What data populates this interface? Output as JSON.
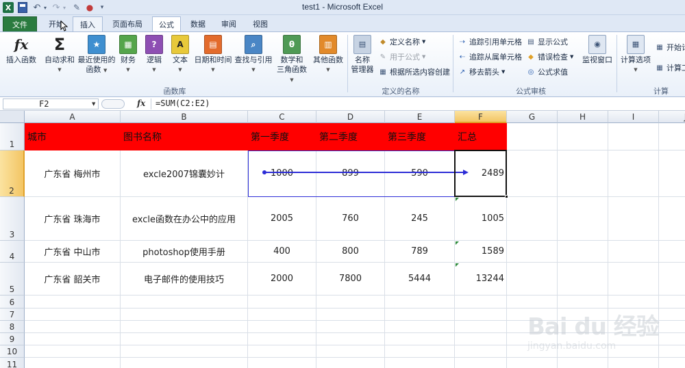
{
  "window": {
    "title": "test1  -  Microsoft Excel"
  },
  "qat": {
    "excel_icon": "X"
  },
  "tabs": {
    "file": "文件",
    "home": "开始",
    "insert": "插入",
    "layout": "页面布局",
    "formulas": "公式",
    "data": "数据",
    "review": "审阅",
    "view": "视图"
  },
  "ribbon": {
    "library": {
      "insert_function": "插入函数",
      "autosum": "自动求和",
      "recent_1": "最近使用的",
      "recent_2": "函数",
      "financial": "财务",
      "logical": "逻辑",
      "text": "文本",
      "datetime": "日期和时间",
      "lookup": "查找与引用",
      "math_1": "数学和",
      "math_2": "三角函数",
      "more": "其他函数",
      "label": "函数库"
    },
    "names": {
      "manager_1": "名称",
      "manager_2": "管理器",
      "define": "定义名称",
      "use": "用于公式",
      "create": "根据所选内容创建",
      "label": "定义的名称"
    },
    "audit": {
      "trace_precedents": "追踪引用单元格",
      "trace_dependents": "追踪从属单元格",
      "remove_arrows": "移去箭头",
      "show_formulas": "显示公式",
      "error_check": "错误检查",
      "evaluate": "公式求值",
      "watch": "监视窗口",
      "label": "公式审核"
    },
    "calc": {
      "options": "计算选项",
      "calc_now": "开始计",
      "calc_sheet": "计算工",
      "label": "计算"
    }
  },
  "formula_bar": {
    "name_box": "F2",
    "fx": "fx",
    "formula": "=SUM(C2:E2)"
  },
  "columns": [
    "A",
    "B",
    "C",
    "D",
    "E",
    "F",
    "G",
    "H",
    "I",
    "J"
  ],
  "rows": [
    "1",
    "2",
    "3",
    "4",
    "5",
    "6",
    "7",
    "8",
    "9",
    "10",
    "11"
  ],
  "sheet": {
    "headers": [
      "城市",
      "图书名称",
      "第一季度",
      "第二季度",
      "第三季度",
      "汇总"
    ],
    "data": [
      [
        "广东省 梅州市",
        "excle2007锦囊妙计",
        "1000",
        "899",
        "590",
        "2489"
      ],
      [
        "广东省 珠海市",
        "excle函数在办公中的应用",
        "2005",
        "760",
        "245",
        "1005"
      ],
      [
        "广东省 中山市",
        "photoshop使用手册",
        "400",
        "800",
        "789",
        "1589"
      ],
      [
        "广东省 韶关市",
        "电子邮件的使用技巧",
        "2000",
        "7800",
        "5444",
        "13244"
      ]
    ]
  },
  "colors": {
    "header_fill": "#ff0000",
    "trace_arrow": "#2b2bd6",
    "selected_header": "#f3c564",
    "file_tab": "#2a7b3f"
  },
  "watermark": {
    "brand": "Bai du 经验",
    "url": "jingyan.baidu.com"
  }
}
